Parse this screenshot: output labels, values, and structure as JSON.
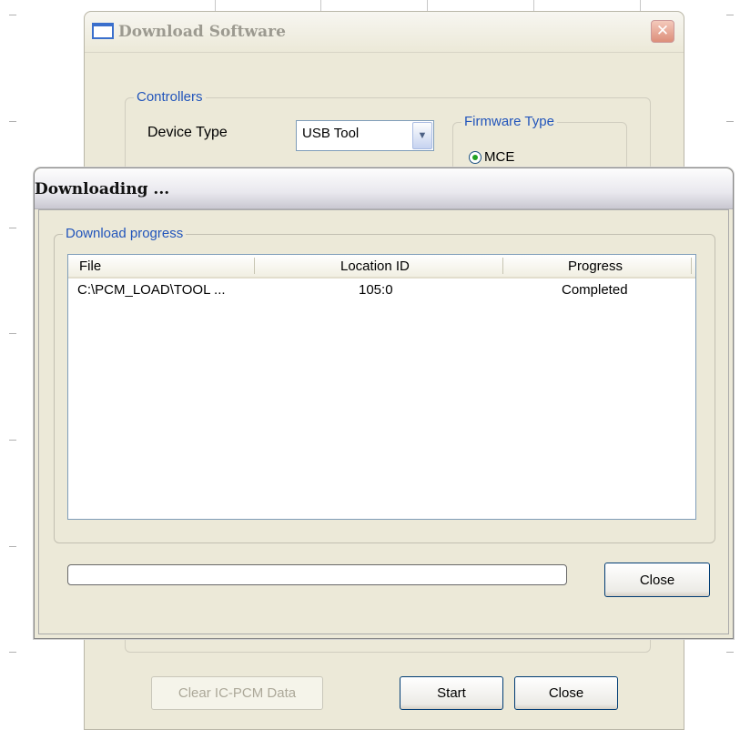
{
  "background_window": {
    "title": "Download Software",
    "controllers_group": {
      "legend": "Controllers",
      "device_type_label": "Device Type",
      "device_type_value": "USB Tool"
    },
    "firmware_group": {
      "legend": "Firmware Type",
      "option_selected": "MCE"
    },
    "buttons": {
      "clear": "Clear IC-PCM Data",
      "start": "Start",
      "close": "Close"
    }
  },
  "dialog": {
    "title": "Downloading ...",
    "group_legend": "Download progress",
    "columns": [
      "File",
      "Location ID",
      "Progress"
    ],
    "rows": [
      {
        "file": "C:\\PCM_LOAD\\TOOL ...",
        "location_id": "105:0",
        "progress": "Completed"
      }
    ],
    "progress_fraction": 0,
    "close_button": "Close"
  },
  "colors": {
    "legend_blue": "#2255bb",
    "dialog_face": "#ece9d8",
    "radio_dot": "#21a121"
  }
}
